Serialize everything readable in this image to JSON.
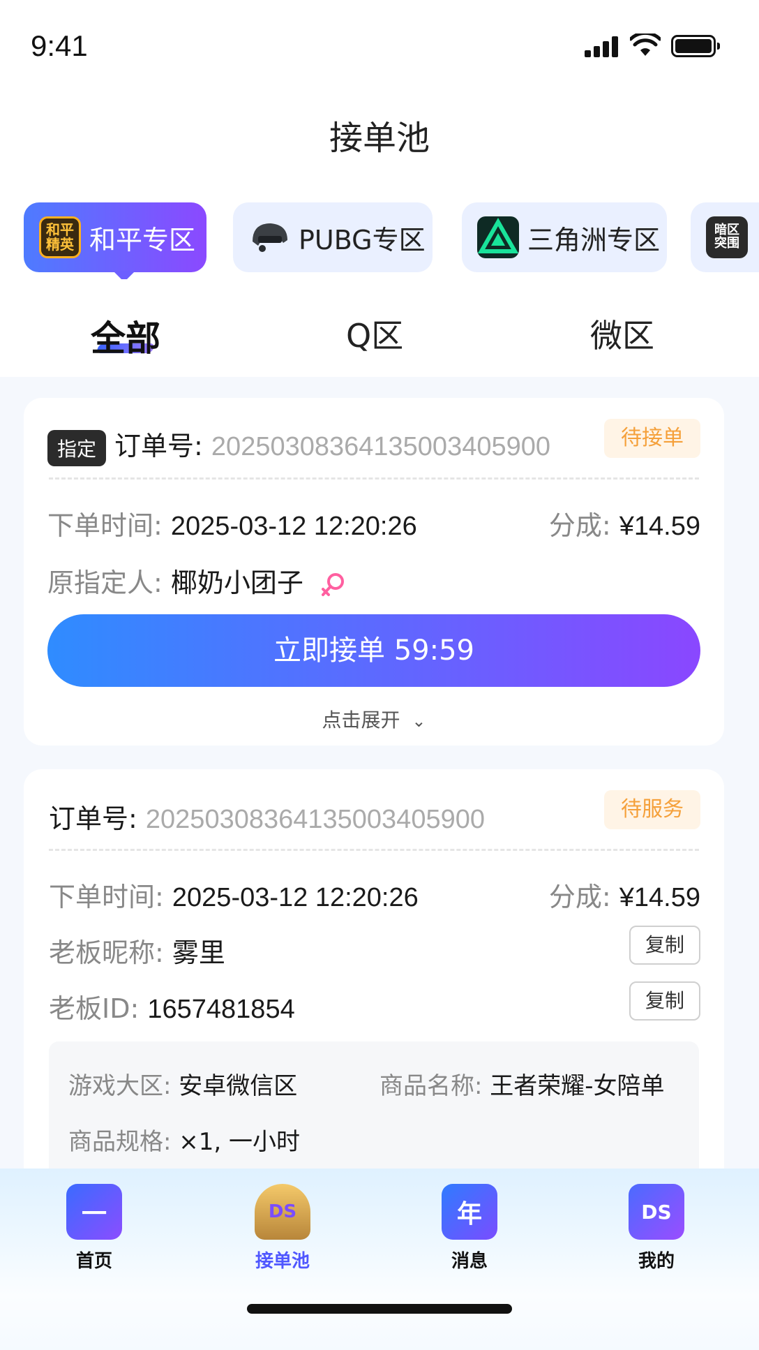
{
  "status_bar": {
    "time": "9:41"
  },
  "page_title": "接单池",
  "zones": [
    {
      "label": "和平专区",
      "icon_name": "peace-elite-icon",
      "icon_text": "和平\n精英",
      "active": true
    },
    {
      "label": "PUBG专区",
      "icon_name": "pubg-helmet-icon",
      "icon_text": "",
      "active": false
    },
    {
      "label": "三角洲专区",
      "icon_name": "delta-force-icon",
      "icon_text": "",
      "active": false
    },
    {
      "label": "",
      "icon_name": "dark-zone-icon",
      "icon_text": "暗区\n突围",
      "active": false
    }
  ],
  "filter_tabs": [
    {
      "label": "全部",
      "active": true
    },
    {
      "label": "Q区",
      "active": false
    },
    {
      "label": "微区",
      "active": false
    }
  ],
  "orders": [
    {
      "tag": "指定",
      "order_label": "订单号:",
      "order_no": "20250308364135003405900",
      "status": "待接单",
      "time_label": "下单时间:",
      "time": "2025-03-12 12:20:26",
      "share_label": "分成:",
      "share": "¥14.59",
      "designee_label": "原指定人:",
      "designee": "椰奶小团子",
      "accept_label": "立即接单 59:59",
      "expand_label": "点击展开"
    },
    {
      "order_label": "订单号:",
      "order_no": "20250308364135003405900",
      "status": "待服务",
      "time_label": "下单时间:",
      "time": "2025-03-12 12:20:26",
      "share_label": "分成:",
      "share": "¥14.59",
      "boss_nick_label": "老板昵称:",
      "boss_nick": "雾里",
      "boss_id_label": "老板ID:",
      "boss_id": "1657481854",
      "copy_label": "复制",
      "region_label": "游戏大区:",
      "region": "安卓微信区",
      "product_label": "商品名称:",
      "product": "王者荣耀-女陪单",
      "spec_label": "商品规格:",
      "spec": "×1, 一小时"
    }
  ],
  "bottom_nav": [
    {
      "label": "首页",
      "icon_name": "home-icon",
      "glyph": "一",
      "active": false
    },
    {
      "label": "接单池",
      "icon_name": "order-pool-trophy-icon",
      "glyph": "DS",
      "active": true
    },
    {
      "label": "消息",
      "icon_name": "message-icon",
      "glyph": "年",
      "active": false
    },
    {
      "label": "我的",
      "icon_name": "profile-icon",
      "glyph": "DS",
      "active": false
    }
  ],
  "colors": {
    "accent_gradient_start": "#2f8cff",
    "accent_gradient_end": "#8a47ff",
    "status_orange": "#f5a03a",
    "female_pink": "#ff5fa0"
  }
}
